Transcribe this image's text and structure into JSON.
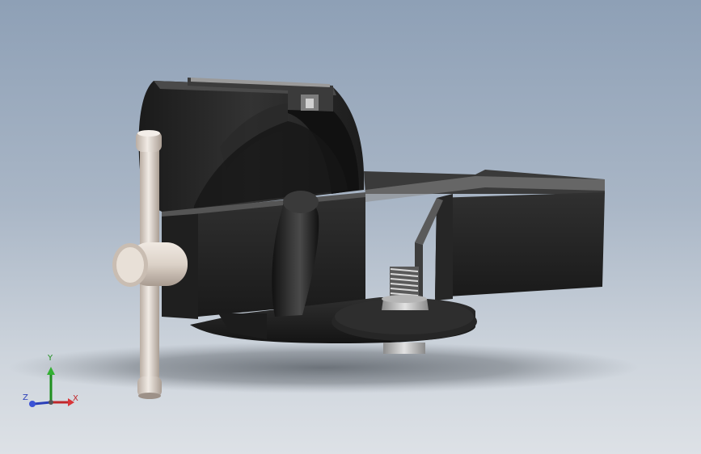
{
  "viewport": {
    "background_top": "#8ea0b6",
    "background_bottom": "#dde1e6"
  },
  "model": {
    "body_color": "#2a2a2a",
    "handle_color": "#e6ddd4",
    "screw_color": "#c4c4c4"
  },
  "triad": {
    "x_label": "X",
    "y_label": "Y",
    "z_label": "Z",
    "x_color": "#c0262a",
    "y_color": "#1f8f1f",
    "z_color": "#2b3fb8"
  }
}
